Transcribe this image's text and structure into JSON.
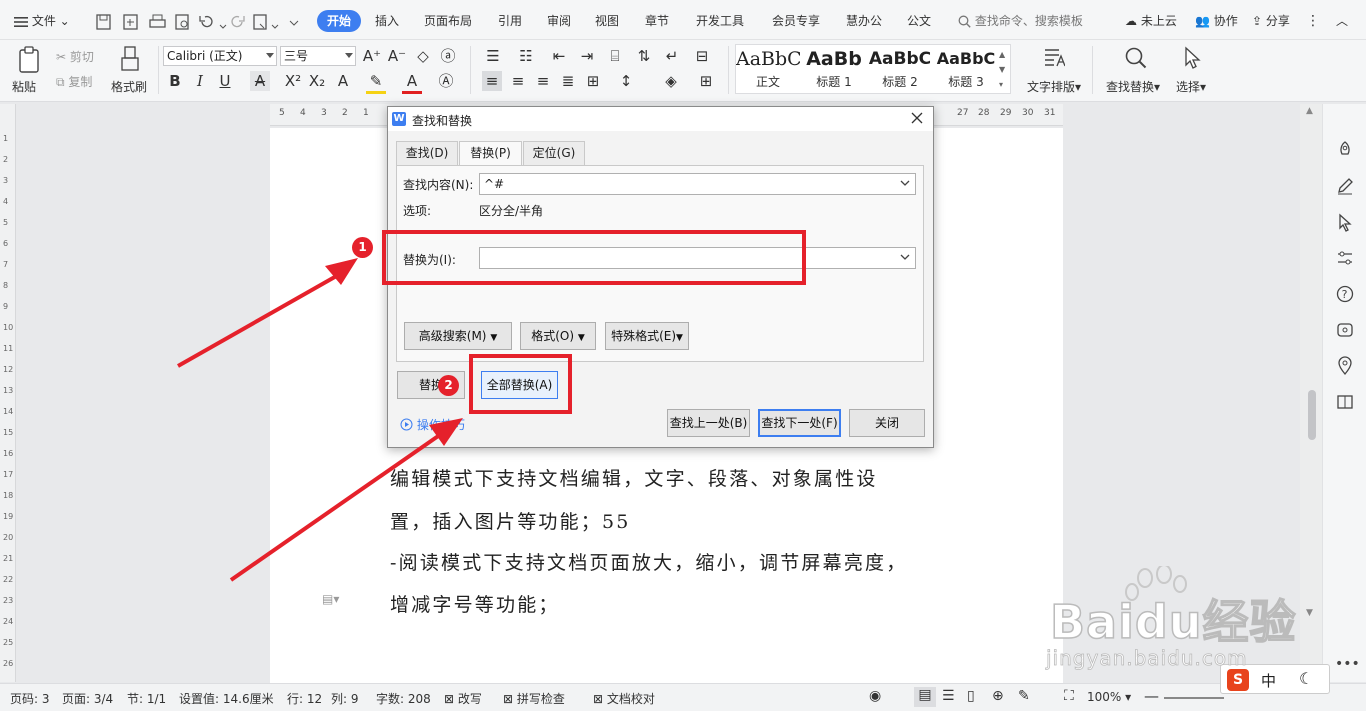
{
  "menubar": {
    "file_label": "文件",
    "tabs": [
      {
        "label": "开始",
        "active": true
      },
      {
        "label": "插入"
      },
      {
        "label": "页面布局"
      },
      {
        "label": "引用"
      },
      {
        "label": "审阅"
      },
      {
        "label": "视图"
      },
      {
        "label": "章节"
      },
      {
        "label": "开发工具"
      },
      {
        "label": "会员专享"
      },
      {
        "label": "慧办公"
      },
      {
        "label": "公文"
      }
    ],
    "search_placeholder": "查找命令、搜索模板",
    "cloud_label": "未上云",
    "collab_label": "协作",
    "share_label": "分享"
  },
  "ribbon": {
    "paste_label": "粘贴",
    "cut_label": "剪切",
    "copy_label": "复制",
    "format_painter_label": "格式刷",
    "font_name": "Calibri (正文)",
    "font_size": "三号",
    "styles": [
      {
        "preview": "AaBbCcI",
        "label": "正文",
        "bold": false
      },
      {
        "preview": "AaBb",
        "label": "标题 1",
        "bold": true
      },
      {
        "preview": "AaBbC",
        "label": "标题 2",
        "bold": true
      },
      {
        "preview": "AaBbC",
        "label": "标题 3",
        "bold": true
      }
    ],
    "text_layout_label": "文字排版",
    "find_replace_label": "查找替换",
    "select_label": "选择"
  },
  "ruler": {
    "left_numbers": [
      "5",
      "4",
      "3",
      "2",
      "1"
    ],
    "right_numbers": [
      "27",
      "28",
      "29",
      "30",
      "31"
    ]
  },
  "vruler": {
    "numbers": [
      "1",
      "2",
      "3",
      "4",
      "5",
      "6",
      "7",
      "8",
      "9",
      "10",
      "11",
      "12",
      "13",
      "14",
      "15",
      "16",
      "17",
      "18",
      "19",
      "20",
      "21",
      "22",
      "23",
      "24",
      "25",
      "26"
    ]
  },
  "document": {
    "lines": [
      "编辑模式下支持文档编辑，文字、段落、对象属性设",
      "置，插入图片等功能；55",
      "-阅读模式下支持文档页面放大，缩小，调节屏幕亮度，",
      "增减字号等功能；"
    ]
  },
  "dialog": {
    "title": "查找和替换",
    "tabs": [
      "查找(D)",
      "替换(P)",
      "定位(G)"
    ],
    "active_tab": 1,
    "find_label": "查找内容(N):",
    "find_value": "^#",
    "options_label": "选项:",
    "options_value": "区分全/半角",
    "replace_label": "替换为(I):",
    "replace_value": "",
    "advanced_label": "高级搜索(M)",
    "format_label": "格式(O)",
    "special_label": "特殊格式(E)",
    "replace_btn": "替换",
    "replace_all_btn": "全部替换(A)",
    "tips_label": "操作技巧",
    "find_prev_btn": "查找上一处(B)",
    "find_next_btn": "查找下一处(F)",
    "close_btn": "关闭"
  },
  "annotations": {
    "badge1": "1",
    "badge2": "2",
    "color": "#e5212b"
  },
  "statusbar": {
    "page_num": "页码: 3",
    "page_count": "页面: 3/4",
    "section": "节: 1/1",
    "setting": "设置值: 14.6厘米",
    "row": "行: 12",
    "col": "列: 9",
    "word_count": "字数: 208",
    "revise": "改写",
    "spellcheck": "拼写检查",
    "proofread": "文档校对",
    "zoom": "100%"
  },
  "ime": {
    "lang": "中"
  },
  "watermark": {
    "brand": "Baidu经验",
    "url": "jingyan.baidu.com"
  },
  "colors": {
    "accent": "#3d7ef0",
    "annotation": "#e5212b"
  }
}
